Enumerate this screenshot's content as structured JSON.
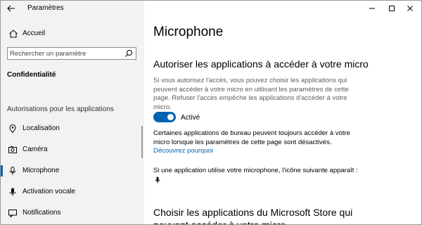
{
  "window": {
    "title": "Paramètres"
  },
  "sidebar": {
    "home_label": "Accueil",
    "search": {
      "placeholder": "Rechercher un paramètre"
    },
    "section_title": "Confidentialité",
    "group_label": "Autorisations pour les applications",
    "items": [
      {
        "label": "Localisation",
        "icon": "location-icon",
        "selected": false
      },
      {
        "label": "Caméra",
        "icon": "camera-icon",
        "selected": false
      },
      {
        "label": "Microphone",
        "icon": "microphone-icon",
        "selected": true
      },
      {
        "label": "Activation vocale",
        "icon": "voice-activation-icon",
        "selected": false
      },
      {
        "label": "Notifications",
        "icon": "notifications-icon",
        "selected": false
      }
    ]
  },
  "main": {
    "title": "Microphone",
    "section1": {
      "heading": "Autoriser les applications à accéder à votre micro",
      "description": "Si vous autorisez l'accès, vous pouvez choisir les applications qui peuvent accéder à votre micro en utilisant les paramètres de cette page. Refuser l'accès empêche les applications d'accéder à votre micro.",
      "toggle_state": "Activé",
      "toggle_on": true,
      "desktop_note": "Certaines applications de bureau peuvent toujours accéder à votre micro lorsque les paramètres de cette page sont désactivés. ",
      "desktop_link": "Découvrez pourquoi",
      "icon_note": "Si une application utilise votre microphone, l'icône suivante apparaît :"
    },
    "section2": {
      "heading": "Choisir les applications du Microsoft Store qui peuvent accéder à votre micro"
    }
  },
  "colors": {
    "accent": "#0063b1",
    "sidebar_bg": "#f2f2f2",
    "secondary_text": "#5e5e5e"
  }
}
